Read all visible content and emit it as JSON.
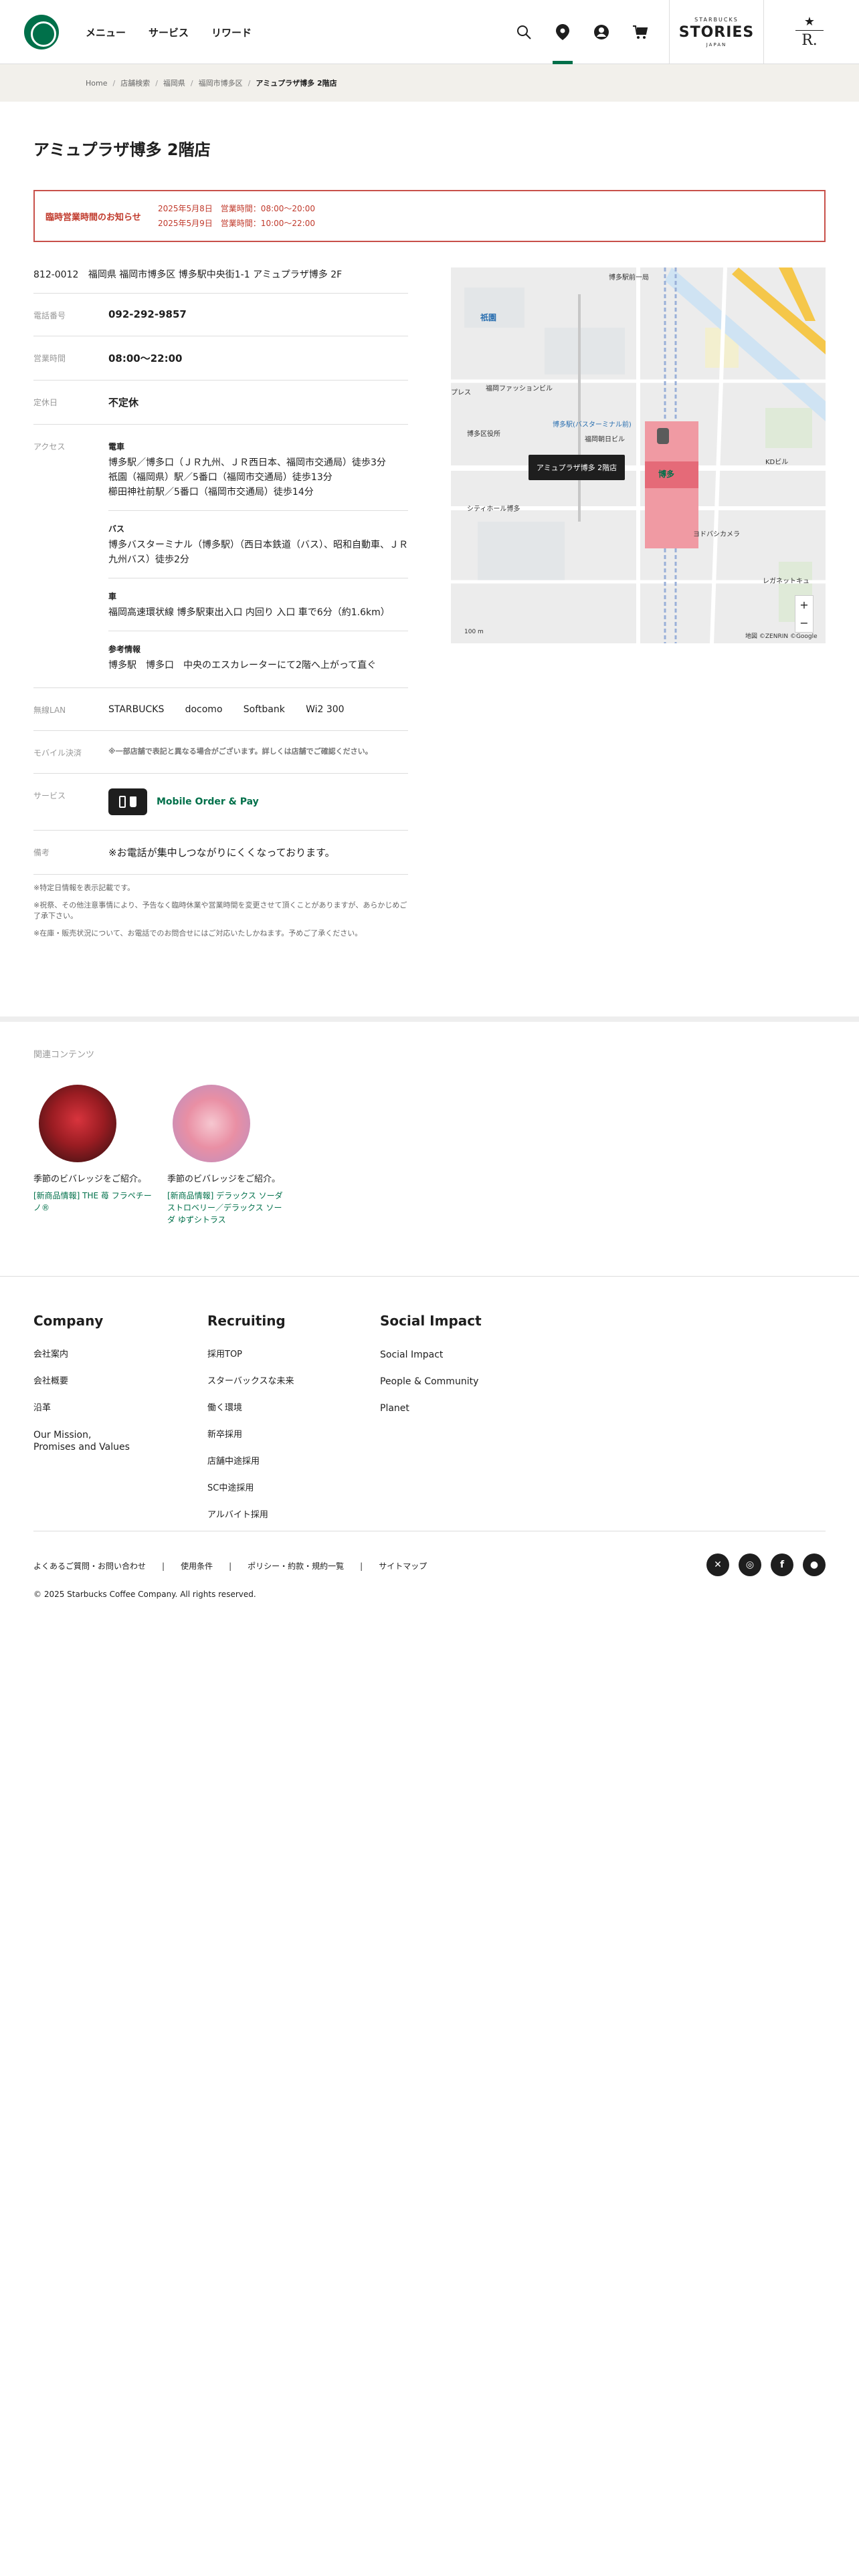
{
  "header": {
    "nav": [
      "メニュー",
      "サービス",
      "リワード"
    ],
    "stories": {
      "line1": "STARBUCKS",
      "line2": "STORIES",
      "line3": "JAPAN"
    },
    "reserve": {
      "letter": "R."
    }
  },
  "breadcrumb": {
    "items": [
      "Home",
      "店舗検索",
      "福岡県",
      "福岡市博多区"
    ],
    "current": "アミュプラザ博多 2階店"
  },
  "page_title": "アミュプラザ博多 2階店",
  "notice": {
    "title": "臨時営業時間のお知らせ",
    "lines": [
      "2025年5月8日　営業時間：08:00〜20:00",
      "2025年5月9日　営業時間：10:00〜22:00"
    ]
  },
  "store": {
    "postal": "812-0012",
    "address": "福岡県 福岡市博多区 博多駅中央街1-1 アミュプラザ博多 2F",
    "rows": {
      "phone": {
        "label": "電話番号",
        "value": "092-292-9857"
      },
      "hours": {
        "label": "営業時間",
        "value": "08:00〜22:00"
      },
      "closed": {
        "label": "定休日",
        "value": "不定休"
      },
      "access": {
        "label": "アクセス"
      },
      "wifi": {
        "label": "無線LAN",
        "items": [
          "STARBUCKS",
          "docomo",
          "Softbank",
          "Wi2 300"
        ]
      },
      "mobile": {
        "label": "モバイル決済",
        "note": "※一部店舗で表記と異なる場合がございます。詳しくは店舗でご確認ください。"
      },
      "services": {
        "label": "サービス",
        "mop": "Mobile Order & Pay"
      },
      "remarks": {
        "label": "備考",
        "value": "※お電話が集中しつながりにくくなっております。"
      }
    },
    "access": {
      "train": {
        "heading": "電車",
        "lines": [
          "博多駅／博多口（ＪＲ九州、ＪＲ西日本、福岡市交通局）徒歩3分",
          "祇園（福岡県）駅／5番口（福岡市交通局）徒歩13分",
          "櫛田神社前駅／5番口（福岡市交通局）徒歩14分"
        ]
      },
      "bus": {
        "heading": "バス",
        "lines": [
          "博多バスターミナル（博多駅）（西日本鉄道（バス）、昭和自動車、ＪＲ九州バス）徒歩2分"
        ]
      },
      "car": {
        "heading": "車",
        "lines": [
          "福岡高速環状線 博多駅東出入口 内回り 入口 車で6分（約1.6km）"
        ]
      },
      "ref": {
        "heading": "参考情報",
        "lines": [
          "博多駅　博多口　中央のエスカレーターにて2階へ上がって直ぐ"
        ]
      }
    },
    "footnotes": [
      "※特定日情報を表示記載です。",
      "※祝祭、その他注意事情により、予告なく臨時休業や営業時間を変更させて頂くことがありますが、あらかじめご了承下さい。",
      "※在庫・販売状況について、お電話でのお問合せにはご対応いたしかねます。予めご了承ください。"
    ]
  },
  "map": {
    "tooltip": "アミュプラザ博多 2階店",
    "scale": "100 m",
    "copyright": "地図 ©ZENRIN ©Google",
    "labels": {
      "station": "博多駅前一局",
      "gion": "祇園",
      "fashion": "福岡ファッションビル",
      "ward": "博多区役所",
      "hakata": "博多",
      "city": "シティホール博多",
      "bic": "ヨドバシカメラ",
      "kitte": "KDビル",
      "bus": "博多駅(バスターミナル前)",
      "nikkei": "福岡朝日ビル",
      "press": "プレス",
      "regal": "レガネットキュ"
    }
  },
  "related": {
    "title": "関連コンテンツ",
    "cards": [
      {
        "title": "季節のビバレッジをご紹介。",
        "link": "[新商品情報] THE 苺 フラペチーノ®"
      },
      {
        "title": "季節のビバレッジをご紹介。",
        "link": "[新商品情報] デラックス ソーダ ストロベリー／デラックス ソーダ ゆずシトラス"
      }
    ]
  },
  "footer": {
    "company": {
      "title": "Company",
      "items": [
        "会社案内",
        "会社概要",
        "沿革",
        "Our Mission,\nPromises and Values"
      ]
    },
    "recruiting": {
      "title": "Recruiting",
      "items": [
        "採用TOP",
        "スターバックスな未来",
        "働く環境",
        "新卒採用",
        "店舗中途採用",
        "SC中途採用",
        "アルバイト採用"
      ]
    },
    "impact": {
      "title": "Social Impact",
      "items": [
        "Social Impact",
        "People & Community",
        "Planet"
      ]
    },
    "links": [
      "よくあるご質問・お問い合わせ",
      "使用条件",
      "ポリシー・約款・規約一覧",
      "サイトマップ"
    ],
    "copyright": "© 2025 Starbucks Coffee Company. All rights reserved."
  },
  "colors": {
    "brand": "#00704a",
    "notice": "#c0392b"
  }
}
